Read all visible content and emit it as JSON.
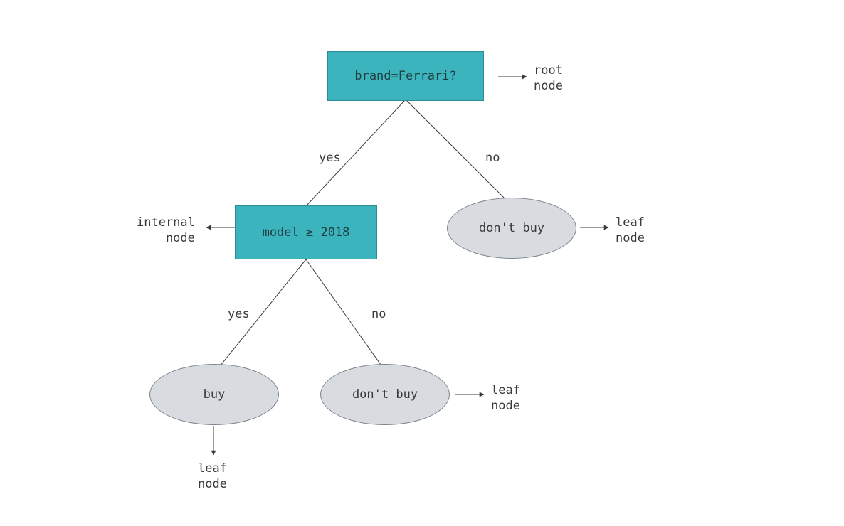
{
  "diagram": {
    "type": "decision-tree",
    "root": {
      "label": "brand=Ferrari?",
      "annotation": "root\nnode",
      "edges": {
        "yes": "yes",
        "no": "no"
      }
    },
    "level2_left": {
      "label": "model ≥ 2018",
      "annotation": "internal\nnode",
      "edges": {
        "yes": "yes",
        "no": "no"
      }
    },
    "level2_right": {
      "label": "don't buy",
      "annotation": "leaf\nnode"
    },
    "level3_left": {
      "label": "buy",
      "annotation": "leaf\nnode"
    },
    "level3_right": {
      "label": "don't buy",
      "annotation": "leaf\nnode"
    }
  },
  "colors": {
    "decision_fill": "#3cb4bd",
    "leaf_fill": "#d8dbe0",
    "text": "#3a3a3a"
  }
}
